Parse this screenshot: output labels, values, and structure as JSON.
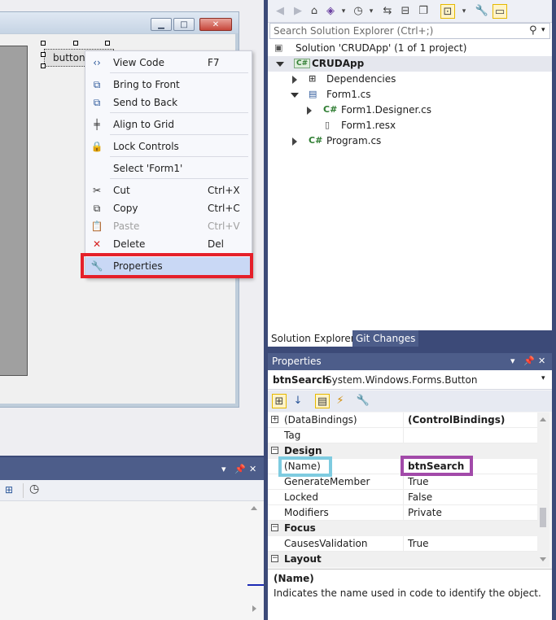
{
  "designer": {
    "button_text": "button"
  },
  "context_menu": {
    "items": [
      {
        "label": "View Code",
        "shortcut": "F7",
        "icon": "code-icon"
      },
      {
        "label": "Bring to Front",
        "shortcut": "",
        "icon": "bring-to-front-icon"
      },
      {
        "label": "Send to Back",
        "shortcut": "",
        "icon": "send-to-back-icon"
      },
      {
        "label": "Align to Grid",
        "shortcut": "",
        "icon": "align-grid-icon"
      },
      {
        "label": "Lock Controls",
        "shortcut": "",
        "icon": "lock-icon"
      },
      {
        "label": "Select 'Form1'",
        "shortcut": "",
        "icon": ""
      },
      {
        "label": "Cut",
        "shortcut": "Ctrl+X",
        "icon": "scissors-icon"
      },
      {
        "label": "Copy",
        "shortcut": "Ctrl+C",
        "icon": "copy-icon"
      },
      {
        "label": "Paste",
        "shortcut": "Ctrl+V",
        "icon": "paste-icon",
        "disabled": true
      },
      {
        "label": "Delete",
        "shortcut": "Del",
        "icon": "delete-icon"
      },
      {
        "label": "Properties",
        "shortcut": "",
        "icon": "wrench-icon",
        "highlighted": true
      }
    ]
  },
  "solution_explorer": {
    "search_placeholder": "Search Solution Explorer (Ctrl+;)",
    "tree": {
      "solution": "Solution 'CRUDApp'   (1 of 1 project)",
      "project": "CRUDApp",
      "project_icon_text": "C#",
      "dependencies": "Dependencies",
      "form1": "Form1.cs",
      "form1_designer": "Form1.Designer.cs",
      "form1_resx": "Form1.resx",
      "program": "Program.cs",
      "cs_icon_text": "C#"
    },
    "tabs": [
      "Solution Explorer",
      "Git Changes"
    ]
  },
  "properties": {
    "title": "Properties",
    "object_name": "btnSearch",
    "object_type": "System.Windows.Forms.Button",
    "rows": [
      {
        "kind": "row",
        "name": "(DataBindings)",
        "value": "(ControlBindings)",
        "bold_value": true,
        "expandable": true
      },
      {
        "kind": "row",
        "name": "Tag",
        "value": ""
      },
      {
        "kind": "category",
        "name": "Design"
      },
      {
        "kind": "row",
        "name": "(Name)",
        "value": "btnSearch",
        "bold_value": true
      },
      {
        "kind": "row",
        "name": "GenerateMember",
        "value": "True"
      },
      {
        "kind": "row",
        "name": "Locked",
        "value": "False"
      },
      {
        "kind": "row",
        "name": "Modifiers",
        "value": "Private"
      },
      {
        "kind": "category",
        "name": "Focus"
      },
      {
        "kind": "row",
        "name": "CausesValidation",
        "value": "True"
      },
      {
        "kind": "category",
        "name": "Layout"
      }
    ],
    "description_title": "(Name)",
    "description_text": "Indicates the name used in code to identify the object."
  },
  "colors": {
    "ide_frame": "#3c4a78",
    "tool_window_title": "#4d5d8a",
    "highlight_red": "#e5202a",
    "highlight_cyan": "#7ecbe0",
    "highlight_purple": "#a24aa9",
    "menu_hover": "#c9d8f5"
  }
}
